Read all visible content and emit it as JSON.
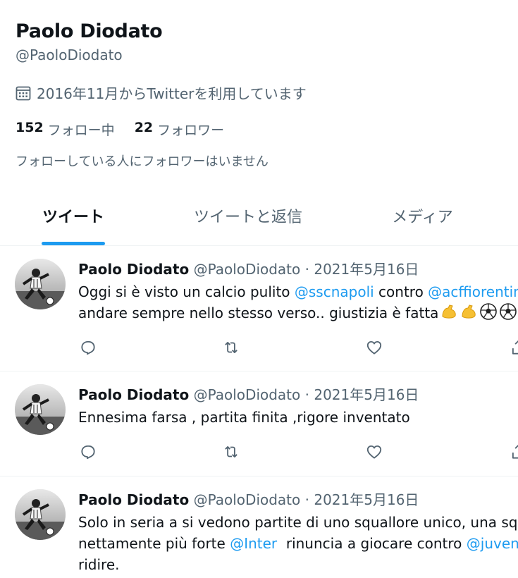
{
  "profile": {
    "name": "Paolo Diodato",
    "handle": "@PaoloDiodato",
    "joined": "2016年11月からTwitterを利用しています",
    "following_count": "152",
    "following_label": "フォロー中",
    "followers_count": "22",
    "followers_label": "フォロワー",
    "no_mutual": "フォローしている人にフォロワーはいません"
  },
  "tabs": {
    "tweets": "ツイート",
    "replies": "ツイートと返信",
    "media": "メディア"
  },
  "tweets": [
    {
      "name": "Paolo Diodato",
      "handle": "@PaoloDiodato",
      "sep": "·",
      "date": "2021年5月16日",
      "line1_a": "Oggi si è visto un calcio pulito ",
      "line1_link1": "@sscnapoli",
      "line1_b": " contro ",
      "line1_link2": "@acffiorentina",
      "line2": "andare sempre nello stesso verso.. giustizia è fatta"
    },
    {
      "name": "Paolo Diodato",
      "handle": "@PaoloDiodato",
      "sep": "·",
      "date": "2021年5月16日",
      "line1": "Ennesima farsa , partita finita ,rigore inventato"
    },
    {
      "name": "Paolo Diodato",
      "handle": "@PaoloDiodato",
      "sep": "·",
      "date": "2021年5月16日",
      "line1": "Solo in seria a si vedono partite di uno squallore unico, una squadra",
      "line2_a": "nettamente più forte ",
      "line2_link1": "@Inter",
      "line2_b": "  rinuncia a giocare contro ",
      "line2_link2": "@juventusfc",
      "line3": "ridire."
    }
  ],
  "colors": {
    "accent": "#1d9bf0",
    "text": "#0f1419",
    "secondary": "#536471",
    "border": "#eff3f4"
  },
  "icons": [
    "calendar-icon",
    "reply-icon",
    "retweet-icon",
    "like-icon",
    "share-icon",
    "flexed-biceps-emoji",
    "soccer-ball-emoji"
  ]
}
